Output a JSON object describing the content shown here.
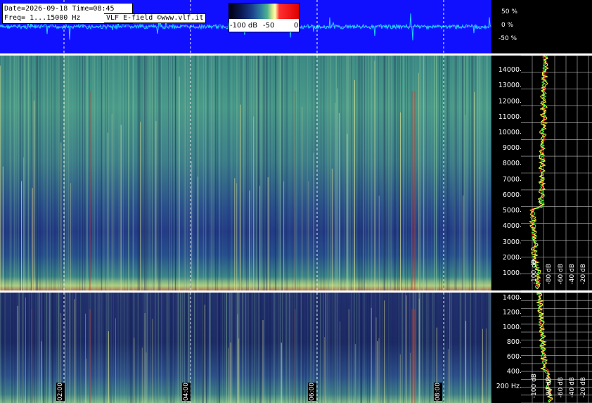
{
  "header": {
    "date_line": "Date=2026-09-18 Time=08:45",
    "freq_line": "Freq= 1...15000 Hz",
    "source_label": "VLF E-field ©www.vlf.it"
  },
  "colorbar": {
    "labels": [
      "-100 dB",
      "-50",
      "0"
    ]
  },
  "waveform": {
    "percent_labels": [
      "50 %",
      "0 %",
      "-50 %"
    ]
  },
  "time_axis": {
    "labels": [
      "02:00",
      "04:00",
      "06:00",
      "08:00"
    ]
  },
  "upper_axis": {
    "ticks": [
      "14000",
      "13000",
      "12000",
      "11000",
      "10000",
      "9000",
      "8000",
      "7000",
      "6000",
      "5000",
      "4000",
      "3000",
      "2000",
      "1000"
    ]
  },
  "lower_axis": {
    "ticks": [
      "1400",
      "1200",
      "1000",
      "800",
      "600",
      "400",
      "200 Hz"
    ]
  },
  "spectrum_upper": {
    "db_labels": [
      "-100 dB",
      "-80 dB",
      "-60 dB",
      "-40 dB",
      "-20 dB"
    ]
  },
  "spectrum_lower": {
    "db_labels": [
      "-100 dB",
      "-80 dB",
      "-60 dB",
      "-40 dB",
      "-20 dB"
    ]
  },
  "colors": {
    "wave_bg": "#1010ff",
    "wave_line": "#20d8ff",
    "spectrum_trace_1": "#ffff40",
    "spectrum_trace_2": "#ff3020",
    "spectrum_trace_3": "#40ff40"
  }
}
